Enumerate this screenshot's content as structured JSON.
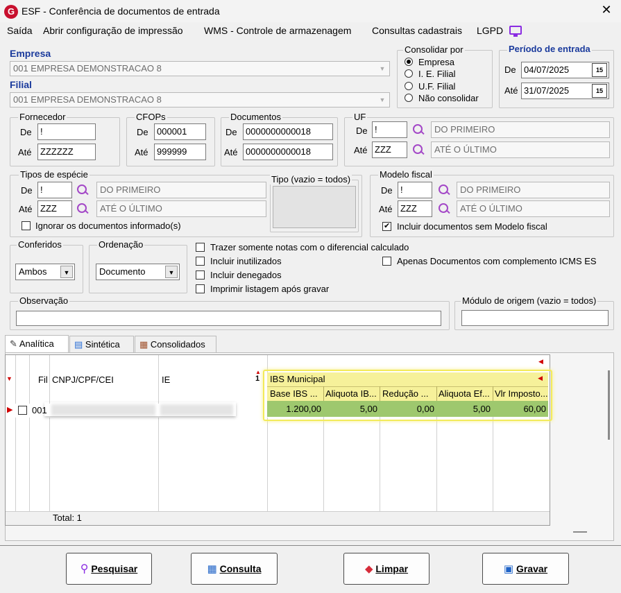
{
  "window": {
    "title": "ESF - Conferência de documentos de entrada",
    "logo": "G"
  },
  "menu": [
    "Saída",
    "Abrir configuração de impressão",
    "WMS - Controle de armazenagem",
    "Consultas cadastrais",
    "LGPD"
  ],
  "empresa": {
    "label": "Empresa",
    "value": "001 EMPRESA DEMONSTRACAO 8"
  },
  "filial": {
    "label": "Filial",
    "value": "001 EMPRESA DEMONSTRACAO 8"
  },
  "consolidar": {
    "label": "Consolidar por",
    "options": [
      "Empresa",
      "I. E. Filial",
      "U.F. Filial",
      "Não consolidar"
    ],
    "selected": "Empresa"
  },
  "periodo": {
    "label": "Período de entrada",
    "de_label": "De",
    "de": "04/07/2025",
    "ate_label": "Até",
    "ate": "31/07/2025"
  },
  "fornecedor": {
    "label": "Fornecedor",
    "de_label": "De",
    "de": "!",
    "ate_label": "Até",
    "ate": "ZZZZZZ"
  },
  "cfops": {
    "label": "CFOPs",
    "de_label": "De",
    "de": "000001",
    "ate_label": "Até",
    "ate": "999999"
  },
  "documentos": {
    "label": "Documentos",
    "de_label": "De",
    "de": "0000000000018",
    "ate_label": "Até",
    "ate": "0000000000018"
  },
  "uf": {
    "label": "UF",
    "de_label": "De",
    "de": "!",
    "de_desc": "DO PRIMEIRO",
    "ate_label": "Até",
    "ate": "ZZZ",
    "ate_desc": "ATÉ O ÚLTIMO"
  },
  "tipos_especie": {
    "label": "Tipos de espécie",
    "de_label": "De",
    "de": "!",
    "de_desc": "DO PRIMEIRO",
    "ate_label": "Até",
    "ate": "ZZZ",
    "ate_desc": "ATÉ O ÚLTIMO",
    "ignorar_label": "Ignorar os documentos informado(s)"
  },
  "tipo_vazio": {
    "label": "Tipo (vazio = todos)"
  },
  "modelo_fiscal": {
    "label": "Modelo fiscal",
    "de_label": "De",
    "de": "!",
    "de_desc": "DO PRIMEIRO",
    "ate_label": "Até",
    "ate": "ZZZ",
    "ate_desc": "ATÉ O ÚLTIMO",
    "incluir_label": "Incluir documentos sem Modelo fiscal"
  },
  "conferidos": {
    "label": "Conferidos",
    "value": "Ambos"
  },
  "ordenacao": {
    "label": "Ordenação",
    "value": "Documento"
  },
  "options": {
    "diferencial": "Trazer somente notas com o diferencial calculado",
    "inutilizados": "Incluir inutilizados",
    "denegados": "Incluir denegados",
    "imprimir": "Imprimir listagem após gravar",
    "complemento": "Apenas Documentos com complemento ICMS ES"
  },
  "observacao": {
    "label": "Observação",
    "value": ""
  },
  "modulo": {
    "label": "Módulo de origem (vazio = todos)",
    "value": ""
  },
  "tabs": [
    "Analítica",
    "Sintética",
    "Consolidados"
  ],
  "grid": {
    "headers": {
      "fil": "Fil",
      "cnpj": "CNPJ/CPF/CEI",
      "ie": "IE",
      "sort_num": "1"
    },
    "ibs_group": "IBS Municipal",
    "ibs_cols": [
      "Base IBS ...",
      "Aliquota IB...",
      "Redução ...",
      "Aliquota Ef...",
      "Vlr Imposto..."
    ],
    "row": {
      "fil": "001",
      "ibs": [
        "1.200,00",
        "5,00",
        "0,00",
        "5,00",
        "60,00"
      ]
    },
    "total": "Total: 1"
  },
  "buttons": {
    "pesquisar": "Pesquisar",
    "consulta": "Consulta",
    "limpar": "Limpar",
    "gravar": "Gravar"
  }
}
